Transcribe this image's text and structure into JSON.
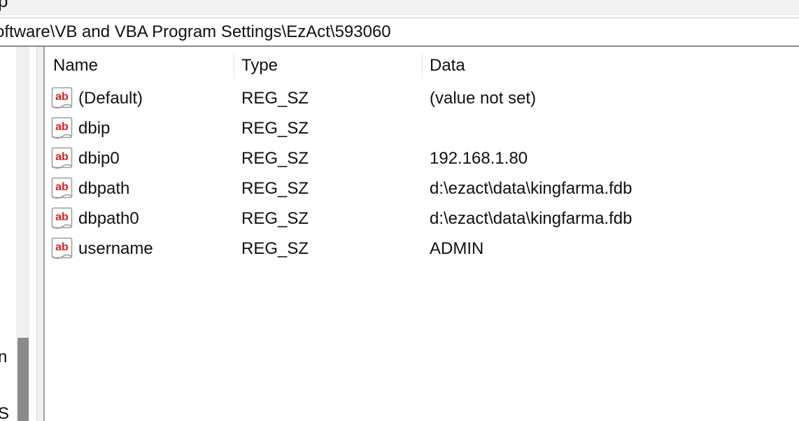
{
  "menu": {
    "fragment": "p"
  },
  "address": {
    "path": "oftware\\VB and VBA Program Settings\\EzAct\\593060"
  },
  "tree": {
    "partial_labels": [
      "n",
      "S"
    ]
  },
  "columns": {
    "name": "Name",
    "type": "Type",
    "data": "Data"
  },
  "rows": [
    {
      "name": "(Default)",
      "type": "REG_SZ",
      "data": "(value not set)",
      "icon": "string-value-icon"
    },
    {
      "name": "dbip",
      "type": "REG_SZ",
      "data": "",
      "icon": "string-value-icon"
    },
    {
      "name": "dbip0",
      "type": "REG_SZ",
      "data": "192.168.1.80",
      "icon": "string-value-icon"
    },
    {
      "name": "dbpath",
      "type": "REG_SZ",
      "data": "d:\\ezact\\data\\kingfarma.fdb",
      "icon": "string-value-icon"
    },
    {
      "name": "dbpath0",
      "type": "REG_SZ",
      "data": "d:\\ezact\\data\\kingfarma.fdb",
      "icon": "string-value-icon"
    },
    {
      "name": "username",
      "type": "REG_SZ",
      "data": "ADMIN",
      "icon": "string-value-icon"
    }
  ],
  "colors": {
    "scroll_thumb": "#8a8a8a",
    "icon_red": "#d42020",
    "chrome": "#f3f3f3"
  }
}
